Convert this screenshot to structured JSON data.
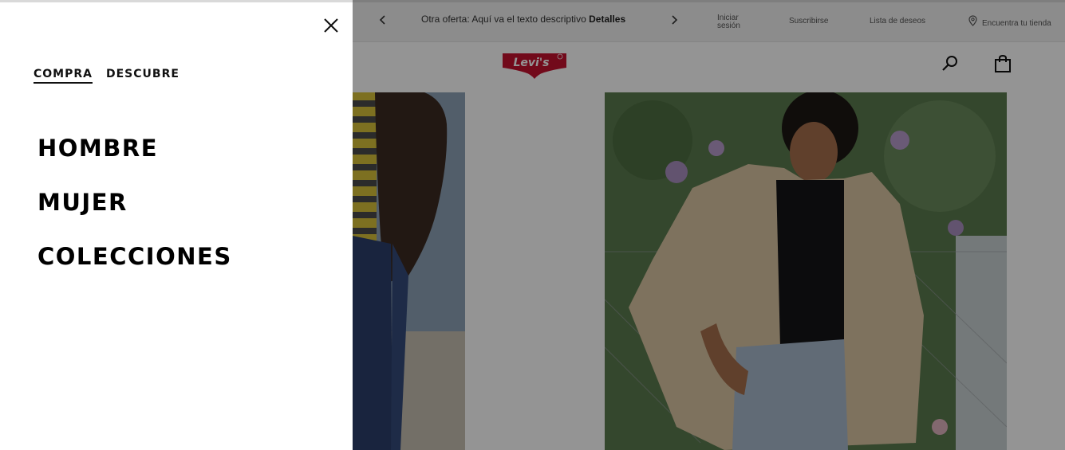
{
  "promo": {
    "text": "Otra oferta: Aquí va el texto descriptivo",
    "link": "Detalles"
  },
  "utility": {
    "signin": "Iniciar sesión",
    "subscribe": "Suscribirse",
    "wishlist": "Lista de deseos",
    "store": "Encuentra tu tienda"
  },
  "header": {
    "logo_text": "Levi's",
    "brand_color": "#c41230"
  },
  "drawer": {
    "tabs": [
      {
        "label": "COMPRA",
        "active": true
      },
      {
        "label": "DESCUBRE",
        "active": false
      }
    ],
    "categories": [
      {
        "label": "HOMBRE"
      },
      {
        "label": "MUJER"
      },
      {
        "label": "COLECCIONES"
      }
    ]
  },
  "icons": {
    "close": "close-icon",
    "prev": "chevron-left-icon",
    "next": "chevron-right-icon",
    "store": "location-pin-icon",
    "search": "search-icon",
    "cart": "shopping-bag-icon"
  }
}
